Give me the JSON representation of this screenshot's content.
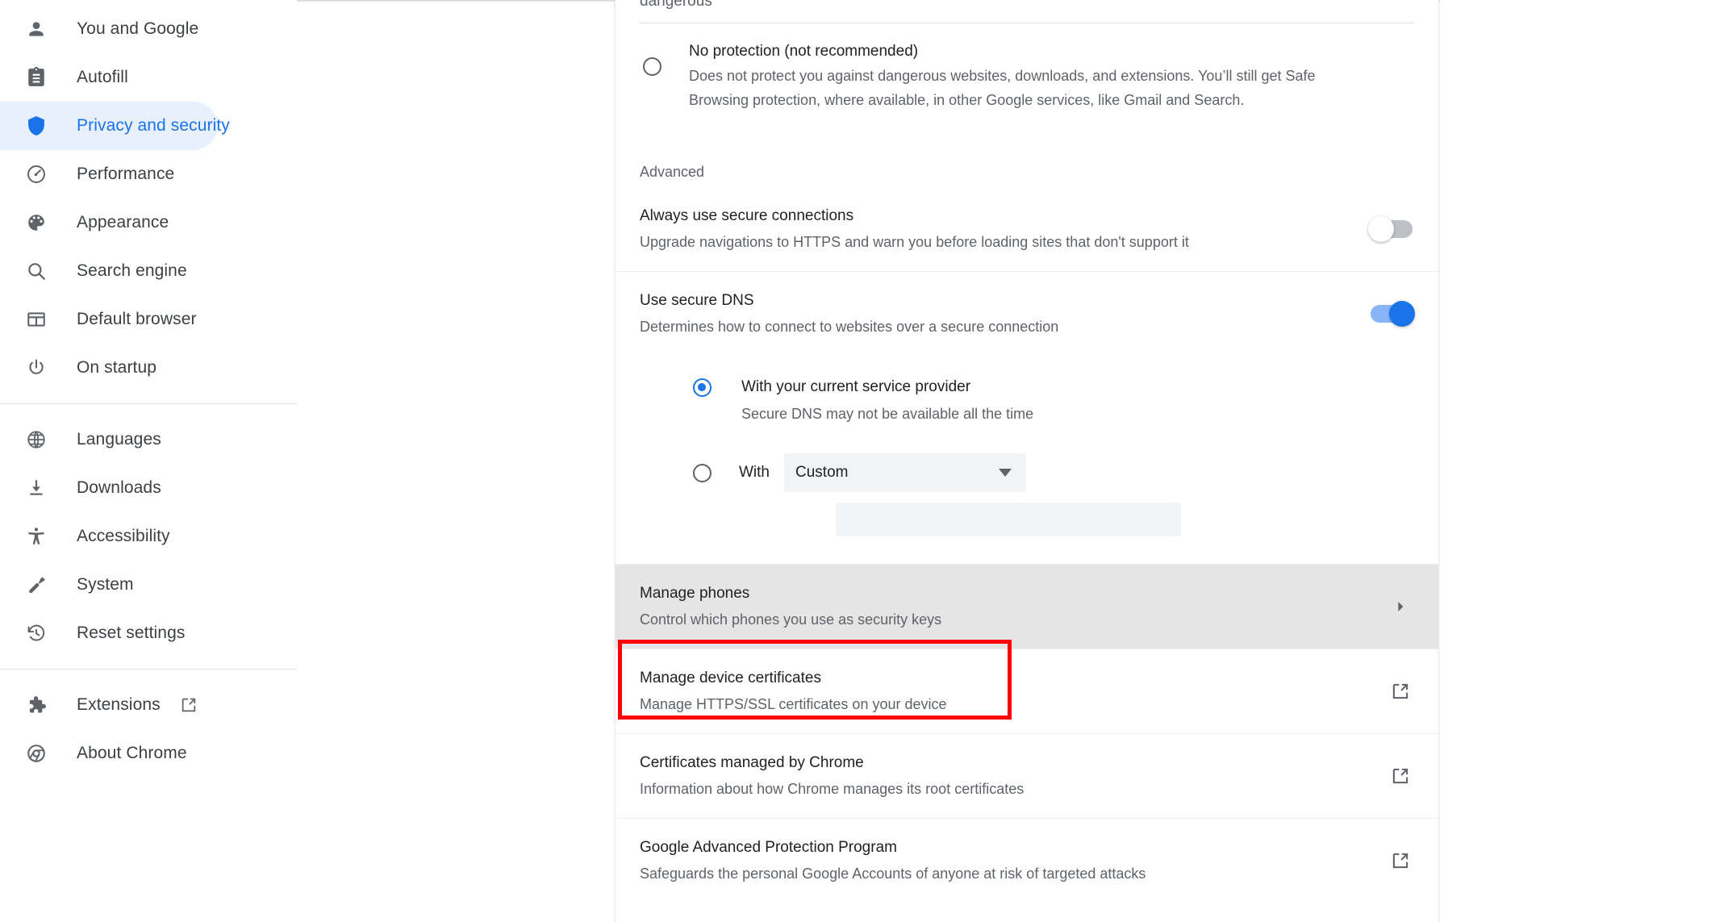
{
  "sidebar": {
    "groups": [
      {
        "items": [
          {
            "label": "You and Google",
            "icon": "person-icon",
            "active": false
          },
          {
            "label": "Autofill",
            "icon": "clipboard-icon",
            "active": false
          },
          {
            "label": "Privacy and security",
            "icon": "shield-icon",
            "active": true
          },
          {
            "label": "Performance",
            "icon": "speedometer-icon",
            "active": false
          },
          {
            "label": "Appearance",
            "icon": "palette-icon",
            "active": false
          },
          {
            "label": "Search engine",
            "icon": "search-icon",
            "active": false
          },
          {
            "label": "Default browser",
            "icon": "browser-window-icon",
            "active": false
          },
          {
            "label": "On startup",
            "icon": "power-icon",
            "active": false
          }
        ]
      },
      {
        "items": [
          {
            "label": "Languages",
            "icon": "globe-icon",
            "active": false
          },
          {
            "label": "Downloads",
            "icon": "download-icon",
            "active": false
          },
          {
            "label": "Accessibility",
            "icon": "accessibility-icon",
            "active": false
          },
          {
            "label": "System",
            "icon": "wrench-icon",
            "active": false
          },
          {
            "label": "Reset settings",
            "icon": "history-restore-icon",
            "active": false
          }
        ]
      },
      {
        "items": [
          {
            "label": "Extensions",
            "icon": "puzzle-icon",
            "external": true,
            "active": false
          },
          {
            "label": "About Chrome",
            "icon": "chrome-logo-icon",
            "active": false
          }
        ]
      }
    ]
  },
  "main": {
    "clipped_text": "dangerous",
    "no_protection": {
      "title": "No protection (not recommended)",
      "desc_line1": "Does not protect you against dangerous websites, downloads, and extensions. You’ll still get Safe",
      "desc_line2": "Browsing protection, where available, in other Google services, like Gmail and Search.",
      "selected": false
    },
    "advanced_label": "Advanced",
    "always_secure": {
      "title": "Always use secure connections",
      "desc": "Upgrade navigations to HTTPS and warn you before loading sites that don't support it",
      "toggle_on": false
    },
    "secure_dns": {
      "title": "Use secure DNS",
      "desc": "Determines how to connect to websites over a secure connection",
      "toggle_on": true,
      "option_provider": {
        "label": "With your current service provider",
        "sub": "Secure DNS may not be available all the time",
        "selected": true
      },
      "option_custom": {
        "with_label": "With",
        "selected_value": "Custom",
        "selected": false,
        "input_value": ""
      }
    },
    "rows": [
      {
        "title": "Manage phones",
        "desc": "Control which phones you use as security keys",
        "trailing": "chevron-right-icon",
        "highlighted": true
      },
      {
        "title": "Manage device certificates",
        "desc": "Manage HTTPS/SSL certificates on your device",
        "trailing": "external-link-icon",
        "highlighted": false,
        "annotated": true
      },
      {
        "title": "Certificates managed by Chrome",
        "desc": "Information about how Chrome manages its root certificates",
        "trailing": "external-link-icon",
        "highlighted": false
      },
      {
        "title": "Google Advanced Protection Program",
        "desc": "Safeguards the personal Google Accounts of anyone at risk of targeted attacks",
        "trailing": "external-link-icon",
        "highlighted": false
      }
    ]
  },
  "colors": {
    "accent": "#1a73e8",
    "accent_light": "#8ab4f8",
    "active_bg": "#e8f0fe",
    "annotation": "#ff0000",
    "row_highlight": "#e5e5e5",
    "text_primary": "#202124",
    "text_secondary": "#5f6368"
  }
}
